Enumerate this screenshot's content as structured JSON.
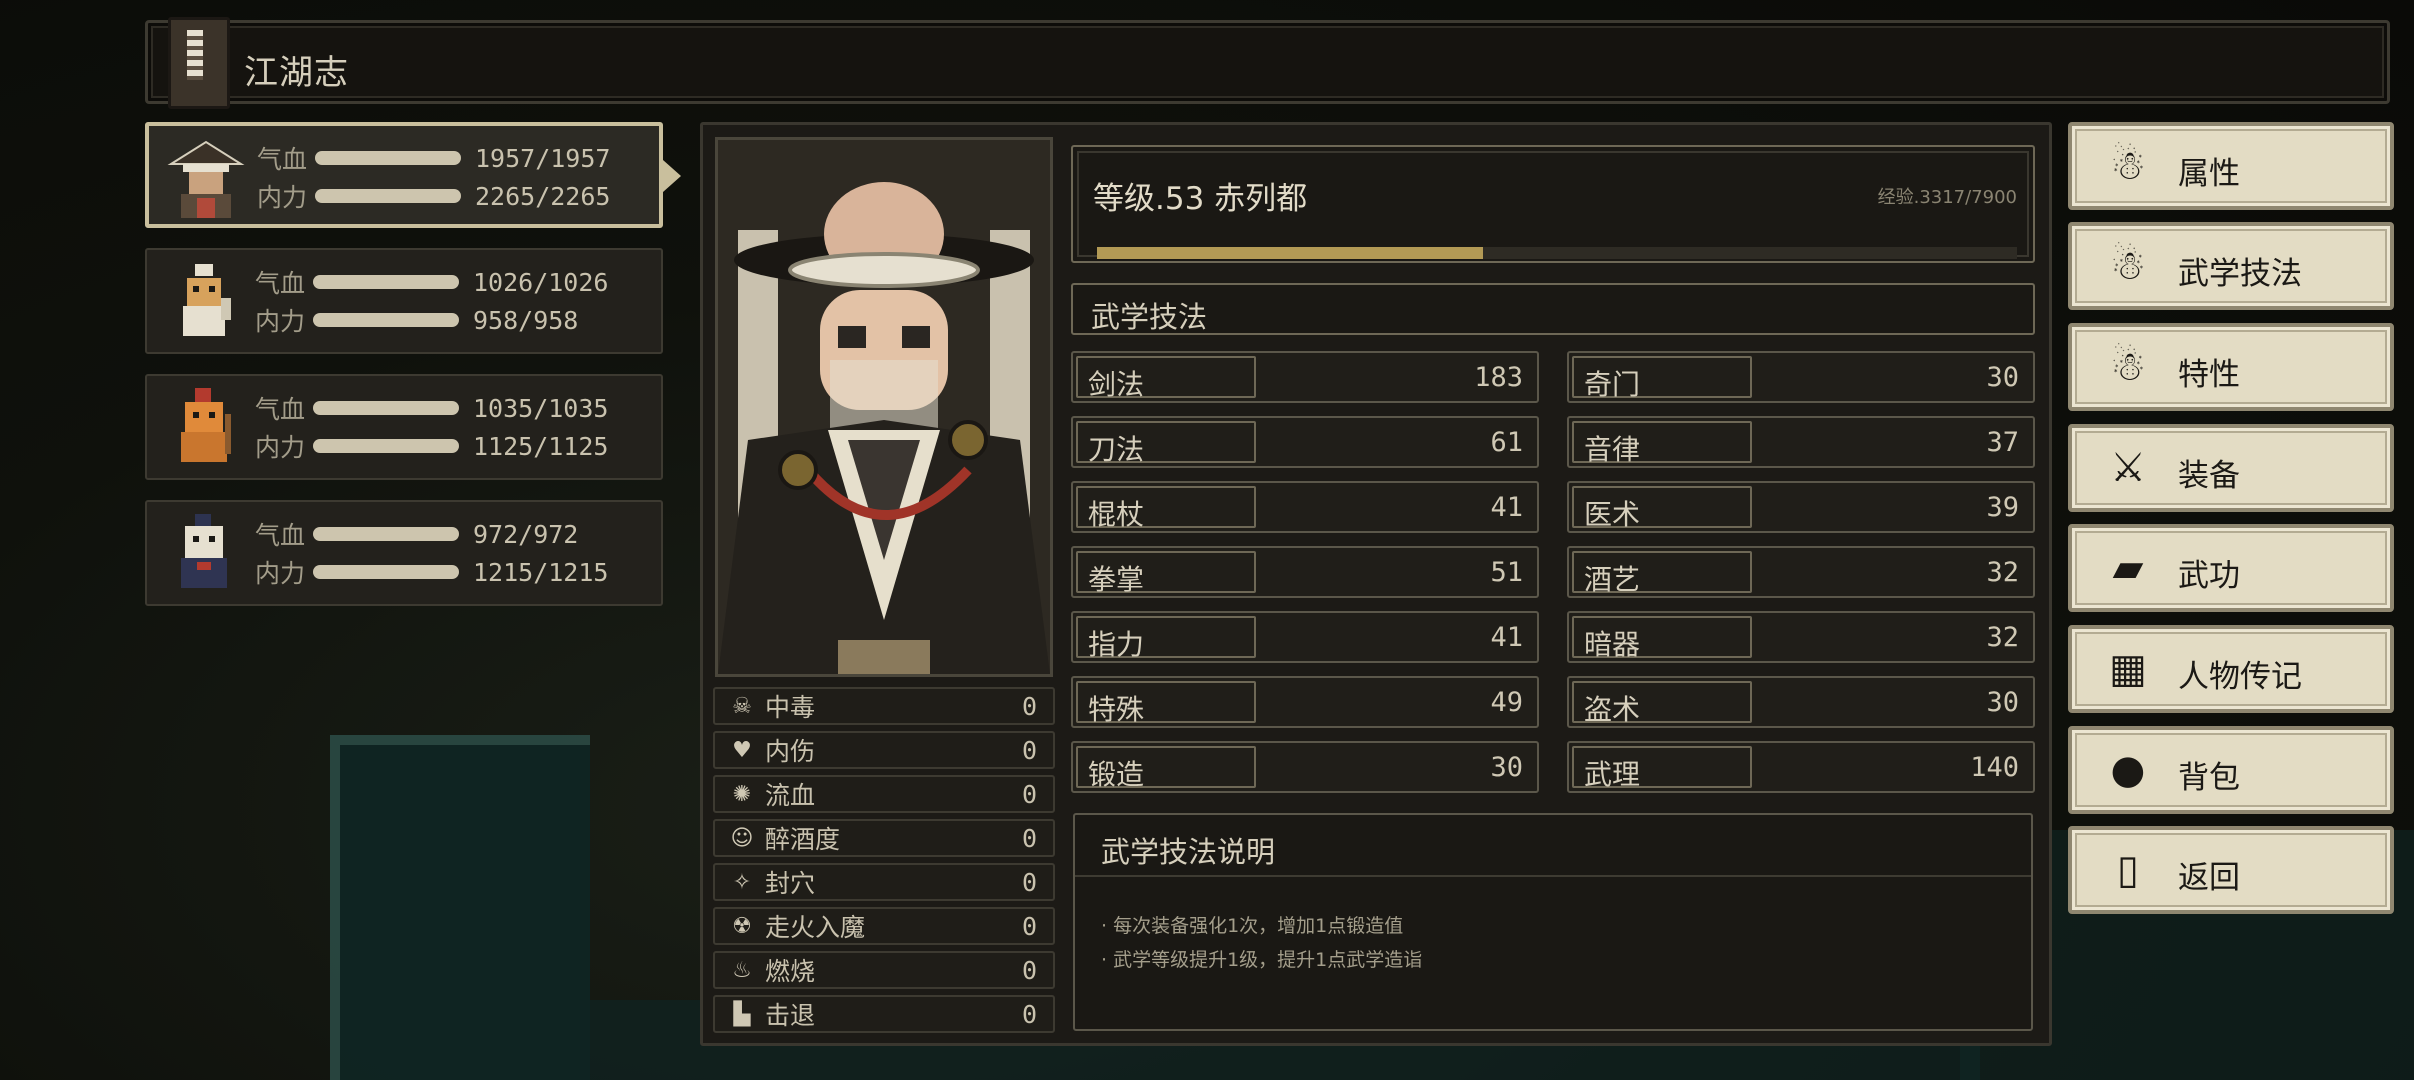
{
  "header": {
    "title": "江湖志"
  },
  "party": [
    {
      "hp_label": "气血",
      "hp": "1957/1957",
      "mp_label": "内力",
      "mp": "2265/2265",
      "active": true
    },
    {
      "hp_label": "气血",
      "hp": "1026/1026",
      "mp_label": "内力",
      "mp": "958/958",
      "active": false
    },
    {
      "hp_label": "气血",
      "hp": "1035/1035",
      "mp_label": "内力",
      "mp": "1125/1125",
      "active": false
    },
    {
      "hp_label": "气血",
      "hp": "972/972",
      "mp_label": "内力",
      "mp": "1215/1215",
      "active": false
    }
  ],
  "character": {
    "level_text": "等级.53 赤列都",
    "exp_text": "经验.3317/7900",
    "exp_fraction": 0.42
  },
  "status_effects": [
    {
      "name": "中毒",
      "value": "0",
      "icon": "skull-icon"
    },
    {
      "name": "内伤",
      "value": "0",
      "icon": "broken-heart-icon"
    },
    {
      "name": "流血",
      "value": "0",
      "icon": "blood-drop-icon"
    },
    {
      "name": "醉酒度",
      "value": "0",
      "icon": "drunk-face-icon"
    },
    {
      "name": "封穴",
      "value": "0",
      "icon": "acupoint-icon"
    },
    {
      "name": "走火入魔",
      "value": "0",
      "icon": "demon-icon"
    },
    {
      "name": "燃烧",
      "value": "0",
      "icon": "fire-icon"
    },
    {
      "name": "击退",
      "value": "0",
      "icon": "boot-icon"
    }
  ],
  "skills_section": {
    "title": "武学技法"
  },
  "skills_left": [
    {
      "name": "剑法",
      "value": "183"
    },
    {
      "name": "刀法",
      "value": "61"
    },
    {
      "name": "棍杖",
      "value": "41"
    },
    {
      "name": "拳掌",
      "value": "51"
    },
    {
      "name": "指力",
      "value": "41"
    },
    {
      "name": "特殊",
      "value": "49"
    },
    {
      "name": "锻造",
      "value": "30"
    }
  ],
  "skills_right": [
    {
      "name": "奇门",
      "value": "30"
    },
    {
      "name": "音律",
      "value": "37"
    },
    {
      "name": "医术",
      "value": "39"
    },
    {
      "name": "酒艺",
      "value": "32"
    },
    {
      "name": "暗器",
      "value": "32"
    },
    {
      "name": "盗术",
      "value": "30"
    },
    {
      "name": "武理",
      "value": "140"
    }
  ],
  "description": {
    "title": "武学技法说明",
    "lines": [
      "· 每次装备强化1次，增加1点锻造值",
      "· 武学等级提升1级，提升1点武学造诣"
    ]
  },
  "menu": [
    {
      "label": "属性",
      "icon": "person-icon"
    },
    {
      "label": "武学技法",
      "icon": "martial-person-icon"
    },
    {
      "label": "特性",
      "icon": "trait-person-icon"
    },
    {
      "label": "装备",
      "icon": "sword-icon"
    },
    {
      "label": "武功",
      "icon": "scroll-book-icon"
    },
    {
      "label": "人物传记",
      "icon": "biography-icon"
    },
    {
      "label": "背包",
      "icon": "bag-icon"
    },
    {
      "label": "返回",
      "icon": "door-icon"
    }
  ],
  "colors": {
    "exp_bar": "#b39a55",
    "menu_bg": "#e3dcc4",
    "panel_bg": "#1c1a16"
  }
}
